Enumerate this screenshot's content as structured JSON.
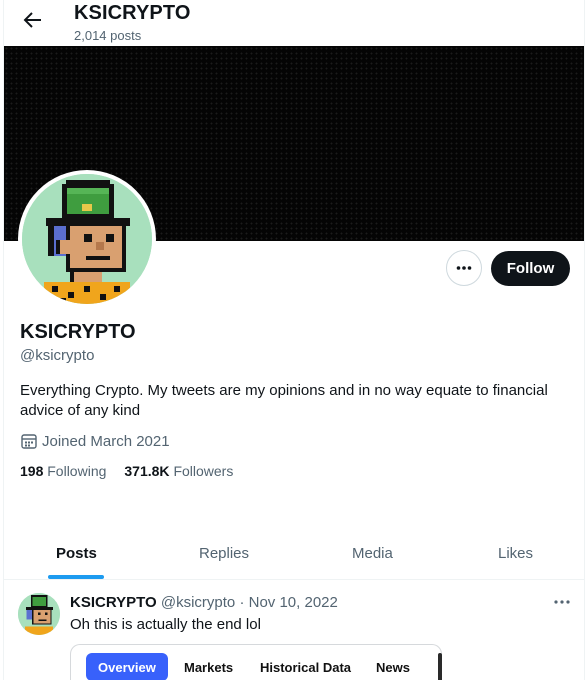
{
  "header": {
    "title": "KSICRYPTO",
    "subtitle": "2,014 posts"
  },
  "actions": {
    "follow_label": "Follow"
  },
  "profile": {
    "name": "KSICRYPTO",
    "handle": "@ksicrypto",
    "bio": "Everything Crypto. My tweets are my opinions and in no way equate to financial advice of any kind",
    "joined": "Joined March 2021",
    "following_count": "198",
    "following_label": "Following",
    "followers_count": "371.8K",
    "followers_label": "Followers"
  },
  "tabs": [
    {
      "label": "Posts",
      "active": true
    },
    {
      "label": "Replies",
      "active": false
    },
    {
      "label": "Media",
      "active": false
    },
    {
      "label": "Likes",
      "active": false
    }
  ],
  "tweet": {
    "author": "KSICRYPTO",
    "handle": "@ksicrypto",
    "separator": "·",
    "date": "Nov 10, 2022",
    "text": "Oh this is actually the end lol",
    "card_tabs": [
      "Overview",
      "Markets",
      "Historical Data",
      "News"
    ],
    "card_active_index": 0
  },
  "colors": {
    "accent": "#1d9bf0",
    "follow_bg": "#0f1419",
    "secondary_text": "#536471",
    "avatar_bg": "#a8e0bd",
    "card_active": "#3861fb"
  },
  "icons": {
    "back": "arrow-left-icon",
    "more": "ellipsis-icon",
    "calendar": "calendar-icon"
  }
}
